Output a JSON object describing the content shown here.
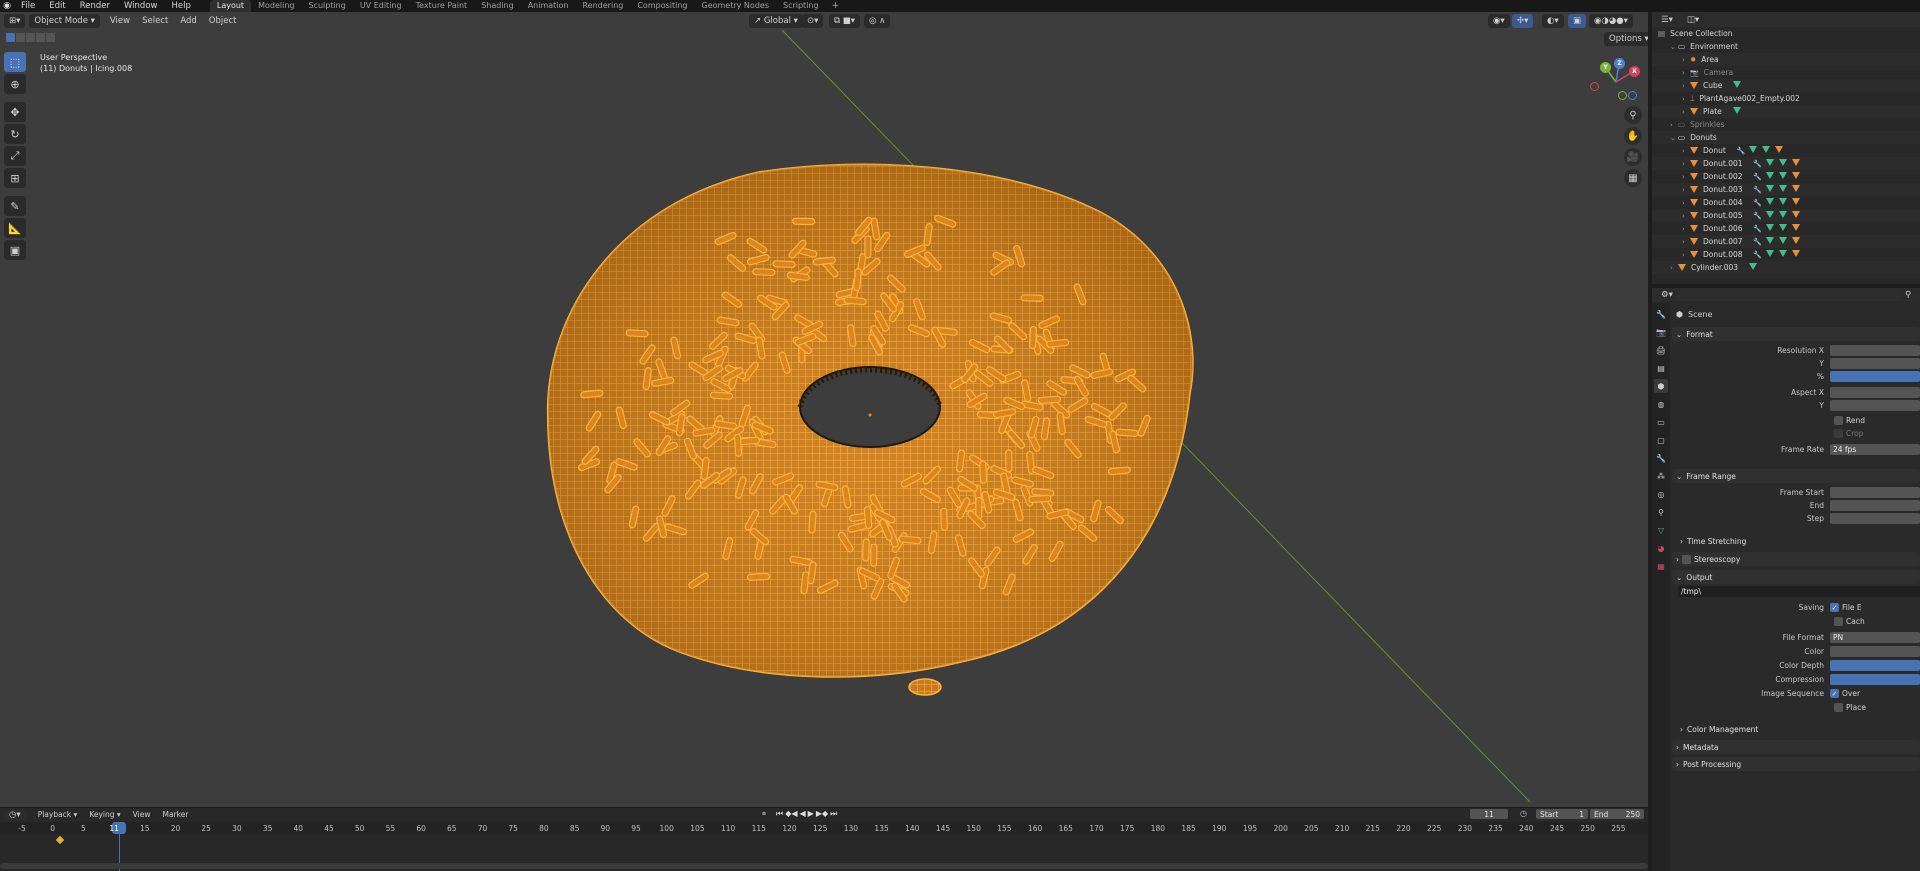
{
  "menubar": {
    "items": [
      "File",
      "Edit",
      "Render",
      "Window",
      "Help"
    ],
    "workspaces": [
      "Layout",
      "Modeling",
      "Sculpting",
      "UV Editing",
      "Texture Paint",
      "Shading",
      "Animation",
      "Rendering",
      "Compositing",
      "Geometry Nodes",
      "Scripting"
    ],
    "active_workspace": "Layout"
  },
  "viewport": {
    "mode": "Object Mode",
    "menus": [
      "View",
      "Select",
      "Add",
      "Object"
    ],
    "orientation": "Global",
    "options_label": "Options",
    "info_line1": "User Perspective",
    "info_line2": "(11) Donuts | Icing.008",
    "gizmo_axes": [
      "Y",
      "Z",
      "X"
    ]
  },
  "outliner": {
    "header": "Scene Collection",
    "rows": [
      {
        "label": "Environment",
        "depth": 1,
        "kind": "collection"
      },
      {
        "label": "Area",
        "depth": 2,
        "kind": "light"
      },
      {
        "label": "Camera",
        "depth": 2,
        "kind": "camera",
        "dim": true
      },
      {
        "label": "Cube",
        "depth": 2,
        "kind": "mesh"
      },
      {
        "label": "PlantAgave002_Empty.002",
        "depth": 2,
        "kind": "empty"
      },
      {
        "label": "Plate",
        "depth": 2,
        "kind": "mesh"
      },
      {
        "label": "Sprinkles",
        "depth": 1,
        "kind": "collection",
        "dim": true
      },
      {
        "label": "Donuts",
        "depth": 1,
        "kind": "collection"
      },
      {
        "label": "Donut",
        "depth": 2,
        "kind": "mesh"
      },
      {
        "label": "Donut.001",
        "depth": 2,
        "kind": "mesh"
      },
      {
        "label": "Donut.002",
        "depth": 2,
        "kind": "mesh"
      },
      {
        "label": "Donut.003",
        "depth": 2,
        "kind": "mesh"
      },
      {
        "label": "Donut.004",
        "depth": 2,
        "kind": "mesh"
      },
      {
        "label": "Donut.005",
        "depth": 2,
        "kind": "mesh"
      },
      {
        "label": "Donut.006",
        "depth": 2,
        "kind": "mesh"
      },
      {
        "label": "Donut.007",
        "depth": 2,
        "kind": "mesh"
      },
      {
        "label": "Donut.008",
        "depth": 2,
        "kind": "mesh"
      },
      {
        "label": "Cylinder.003",
        "depth": 1,
        "kind": "mesh"
      }
    ]
  },
  "properties": {
    "context": "Scene",
    "format_panel": "Format",
    "resolution_x_label": "Resolution X",
    "y_label": "Y",
    "percent_label": "%",
    "aspect_x_label": "Aspect X",
    "render_region_label": "Rend",
    "crop_label": "Crop",
    "frame_rate_label": "Frame Rate",
    "frame_rate_value": "24 fps",
    "frame_range_panel": "Frame Range",
    "frame_start_label": "Frame Start",
    "end_label": "End",
    "step_label": "Step",
    "time_stretching_panel": "Time Stretching",
    "stereoscopy_panel": "Stereoscopy",
    "output_panel": "Output",
    "output_path": "/tmp\\",
    "saving_label": "Saving",
    "file_ext_label": "File E",
    "cache_label": "Cach",
    "file_format_label": "File Format",
    "file_format_value": "PN",
    "color_label": "Color",
    "color_depth_label": "Color Depth",
    "compression_label": "Compression",
    "image_sequence_label": "Image Sequence",
    "overwrite_label": "Over",
    "placeholders_label": "Place",
    "color_management_panel": "Color Management",
    "metadata_panel": "Metadata",
    "post_processing_panel": "Post Processing"
  },
  "timeline": {
    "menus": [
      "Playback",
      "Keying",
      "View",
      "Marker"
    ],
    "current_frame": "11",
    "start_label": "Start",
    "start_value": "1",
    "end_label": "End",
    "end_value": "250",
    "ruler": [
      "-5",
      "0",
      "5",
      "11",
      "15",
      "20",
      "25",
      "30",
      "35",
      "40",
      "45",
      "50",
      "55",
      "60",
      "65",
      "70",
      "75",
      "80",
      "85",
      "90",
      "95",
      "100",
      "105",
      "110",
      "115",
      "120",
      "125",
      "130",
      "135",
      "140",
      "145",
      "150",
      "155",
      "160",
      "165",
      "170",
      "175",
      "180",
      "185",
      "190",
      "195",
      "200",
      "205",
      "210",
      "215",
      "220",
      "225",
      "230",
      "235",
      "240",
      "245",
      "250",
      "255"
    ]
  },
  "colors": {
    "accent": "#4772b3",
    "wire": "#f0a030",
    "viewport_bg": "#3d3d3d"
  }
}
